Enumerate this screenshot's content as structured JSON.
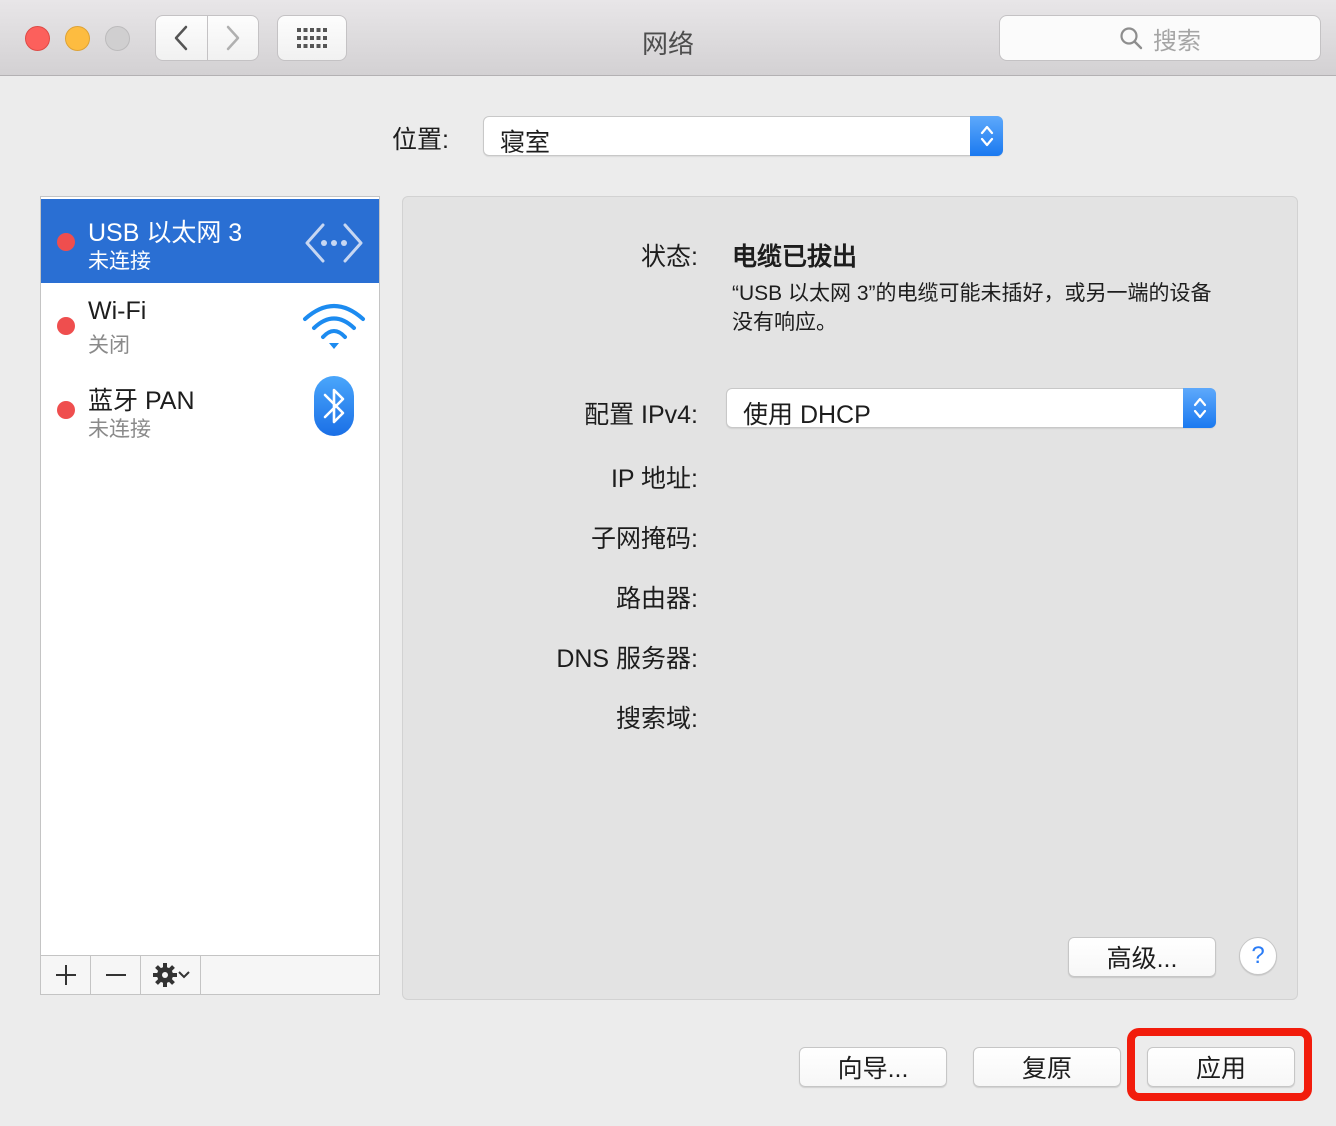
{
  "window": {
    "title": "网络",
    "search_placeholder": "搜索"
  },
  "location": {
    "label": "位置:",
    "value": "寝室"
  },
  "services": [
    {
      "name": "USB 以太网 3",
      "status": "未连接",
      "selected": true,
      "icon": "ethernet-icon"
    },
    {
      "name": "Wi-Fi",
      "status": "关闭",
      "selected": false,
      "icon": "wifi-icon"
    },
    {
      "name": "蓝牙 PAN",
      "status": "未连接",
      "selected": false,
      "icon": "bluetooth-icon"
    }
  ],
  "detail": {
    "status_label": "状态:",
    "status_value": "电缆已拔出",
    "status_description": "“USB 以太网 3”的电缆可能未插好，或另一端的设备没有响应。",
    "ipv4_label": "配置 IPv4:",
    "ipv4_value": "使用 DHCP",
    "ip_label": "IP 地址:",
    "subnet_label": "子网掩码:",
    "router_label": "路由器:",
    "dns_label": "DNS 服务器:",
    "search_domain_label": "搜索域:",
    "advanced_label": "高级...",
    "help_label": "?"
  },
  "footer": {
    "assist_label": "向导...",
    "revert_label": "复原",
    "apply_label": "应用"
  },
  "colors": {
    "selection": "#2a6fd3",
    "status_dot": "#ef4e4e",
    "highlight": "#f21c0c",
    "accent": "#1a79f0"
  }
}
